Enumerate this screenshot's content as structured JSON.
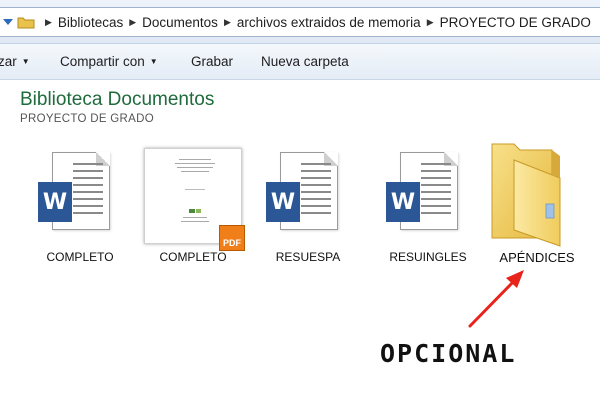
{
  "breadcrumb": [
    "Bibliotecas",
    "Documentos",
    "archivos extraidos de memoria",
    "PROYECTO DE GRADO"
  ],
  "toolbar": {
    "organize_label": "zar",
    "share_label": "Compartir con",
    "burn_label": "Grabar",
    "new_folder_label": "Nueva carpeta"
  },
  "library": {
    "title": "Biblioteca Documentos",
    "subtitle": "PROYECTO DE GRADO"
  },
  "files": [
    {
      "name": "COMPLETO",
      "type": "word-document",
      "icon": "word-document-icon"
    },
    {
      "name": "COMPLETO",
      "type": "pdf-document",
      "icon": "pdf-icon"
    },
    {
      "name": "RESUESPA",
      "type": "word-document",
      "icon": "word-document-icon"
    },
    {
      "name": "RESUINGLES",
      "type": "word-document",
      "icon": "word-document-icon"
    },
    {
      "name": "APÉNDICES",
      "type": "folder",
      "icon": "folder-icon"
    }
  ],
  "annotation": {
    "text": "OPCIONAL",
    "arrow_color": "#e8231b",
    "points_to": "APÉNDICES"
  },
  "colors": {
    "title_green": "#1e6b3c",
    "word_blue": "#2b5797",
    "pdf_orange": "#f07f19",
    "folder_yellow": "#f5d774"
  }
}
